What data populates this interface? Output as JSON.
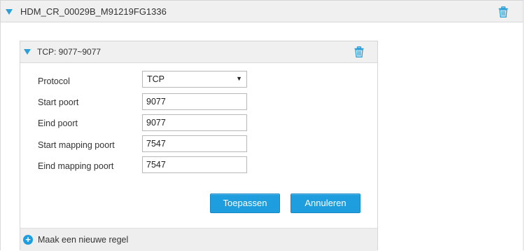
{
  "rule": {
    "title": "HDM_CR_00029B_M91219FG1336",
    "delete_icon": "trash-icon",
    "expand_icon": "triangle-down-icon"
  },
  "mapping": {
    "title": "TCP: 9077~9077",
    "delete_icon": "trash-icon",
    "expand_icon": "triangle-down-icon",
    "fields": {
      "protocol": {
        "label": "Protocol",
        "value": "TCP",
        "arrow": "▼"
      },
      "start_port": {
        "label": "Start poort",
        "value": "9077"
      },
      "end_port": {
        "label": "Eind poort",
        "value": "9077"
      },
      "start_mapping_port": {
        "label": "Start mapping poort",
        "value": "7547"
      },
      "end_mapping_port": {
        "label": "Eind mapping poort",
        "value": "7547"
      }
    },
    "buttons": {
      "apply": "Toepassen",
      "cancel": "Annuleren"
    },
    "add_rule": {
      "icon": "plus-circle-icon",
      "glyph": "+",
      "label": "Maak een nieuwe regel"
    }
  },
  "colors": {
    "accent": "#2a9fd8",
    "button": "#1e9ede",
    "header_bg": "#f0f0f0"
  }
}
